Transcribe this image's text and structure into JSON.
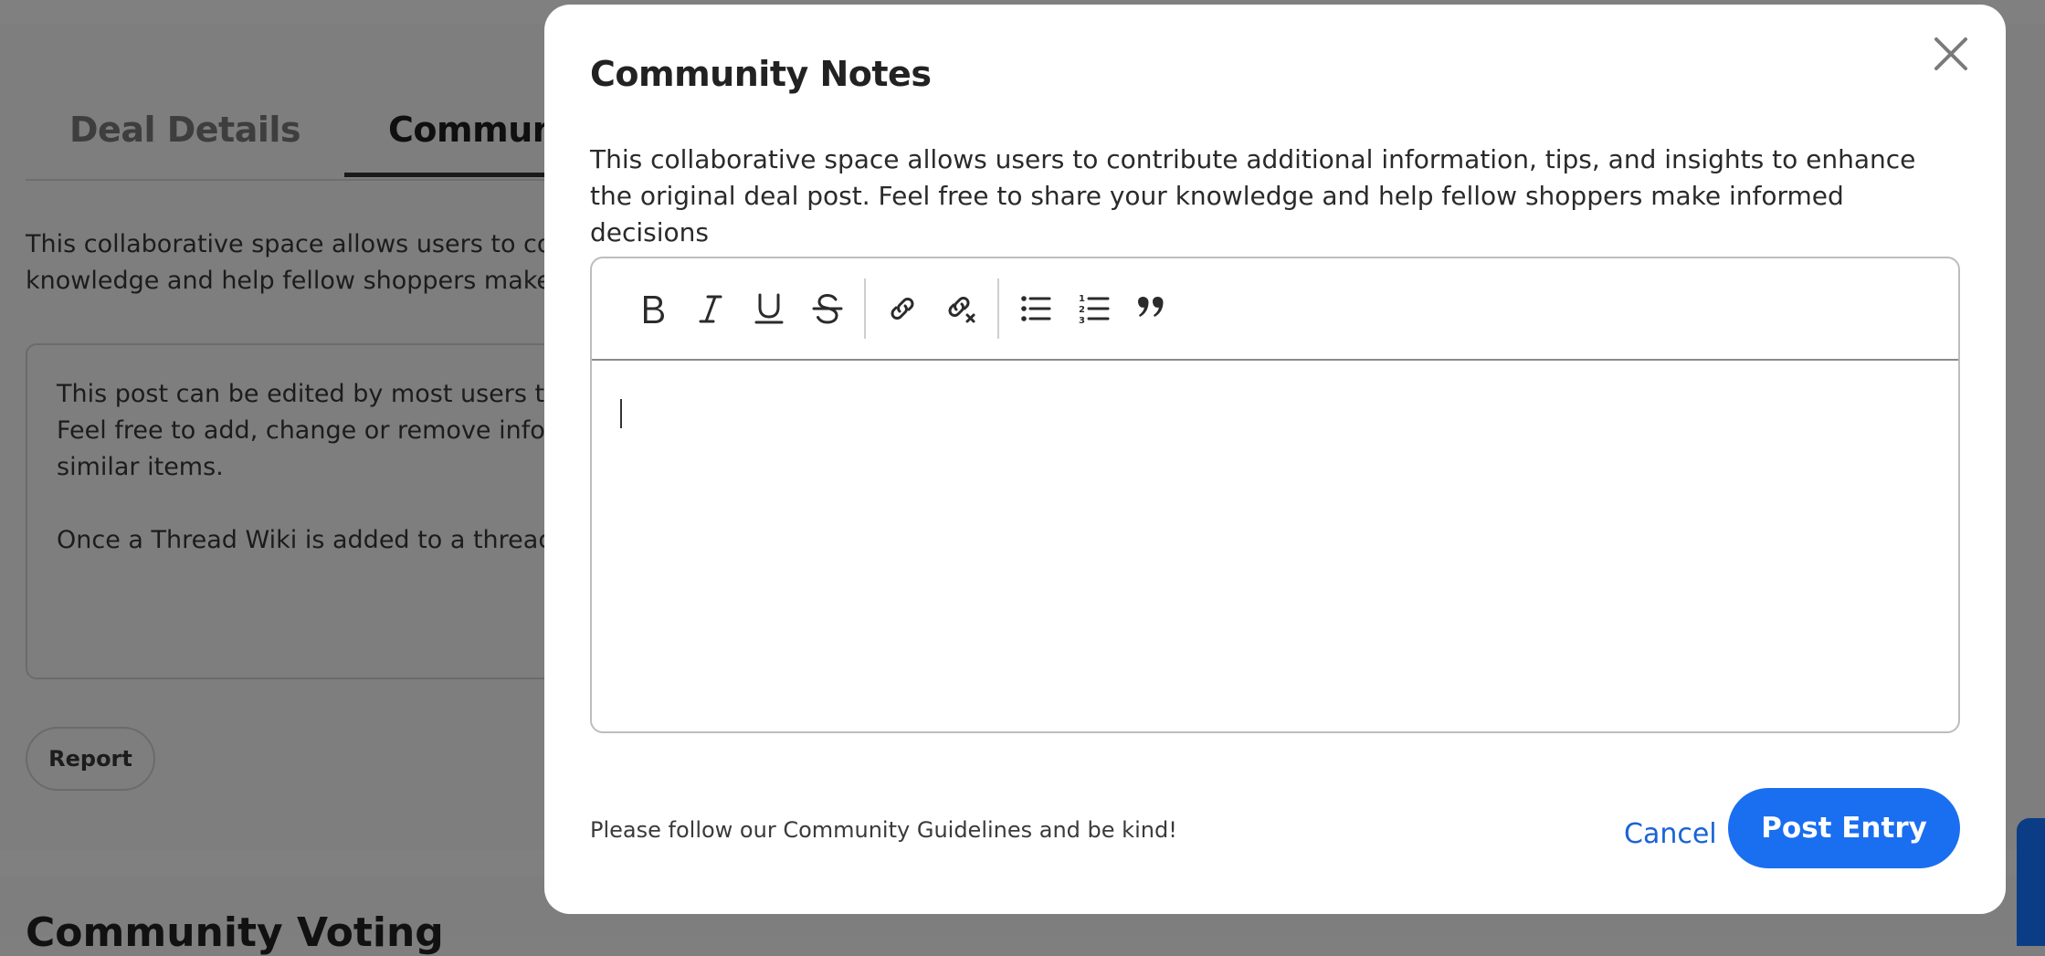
{
  "background": {
    "tabs": [
      {
        "label": "Deal Details"
      },
      {
        "label": "Community"
      }
    ],
    "description_lines": [
      "This collaborative space allows users to co",
      "knowledge and help fellow shoppers make"
    ],
    "wiki_lines": [
      "This post can be edited by most users to",
      "Feel free to add, change or remove infor",
      "similar items.",
      "Once a Thread Wiki is added to a thread,"
    ],
    "report_label": "Report",
    "section_heading": "Community Voting"
  },
  "modal": {
    "title": "Community Notes",
    "description": "This collaborative space allows users to contribute additional information, tips, and insights to enhance the original deal post. Feel free to share your knowledge and help fellow shoppers make informed decisions",
    "toolbar": {
      "bold": "bold-icon",
      "italic": "italic-icon",
      "underline": "underline-icon",
      "strikethrough": "strikethrough-icon",
      "link": "link-icon",
      "unlink": "unlink-icon",
      "bullet_list": "bullet-list-icon",
      "numbered_list": "numbered-list-icon",
      "quote": "quote-icon"
    },
    "editor_value": "",
    "footer_note": "Please follow our Community Guidelines and be kind!",
    "cancel_label": "Cancel",
    "post_label": "Post Entry"
  },
  "colors": {
    "primary": "#1a6ef0",
    "link": "#1a63d6",
    "overlay": "#808080"
  }
}
